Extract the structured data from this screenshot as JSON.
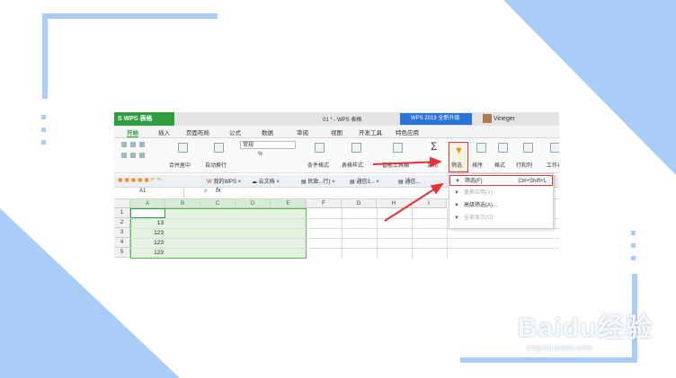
{
  "colors": {
    "frame_blue": "#a9cdf6",
    "wps_green": "#2e9e3f",
    "highlight_red": "#e33333",
    "promo_blue": "#2a73d8"
  },
  "titlebar": {
    "app_name": "S WPS 表格",
    "doc_title": "01 * - WPS 表格",
    "promo": "WPS 2019 全新升级",
    "user": "Vineger"
  },
  "ribbon_tabs": [
    "开始",
    "插入",
    "页面布局",
    "公式",
    "数据",
    "审阅",
    "视图",
    "开发工具",
    "特色应用"
  ],
  "ribbon": {
    "number_format": "常规",
    "percent": "%",
    "labels": {
      "merge": "合并居中",
      "wrap": "自动换行",
      "cond_format": "条件格式",
      "table_style": "表格样式",
      "smart_tools": "智能工具箱",
      "sum": "求和",
      "filter": "筛选",
      "sort": "排序",
      "format": "格式",
      "rowcol": "行和列",
      "worksheet": "工作表"
    }
  },
  "doc_tabs": [
    "我的WPS",
    "云文档",
    "民政...行)",
    "通信3...",
    "通信..."
  ],
  "formula_bar": {
    "cell_ref": "A1",
    "fx": "fx"
  },
  "grid": {
    "columns": [
      "A",
      "B",
      "C",
      "D",
      "E",
      "F",
      "G",
      "H",
      "I"
    ],
    "rows": [
      "1",
      "2",
      "3",
      "4",
      "5"
    ],
    "a_values": [
      "",
      "13",
      "123",
      "123",
      "123"
    ]
  },
  "filter_menu": {
    "items": [
      {
        "label": "筛选(F)",
        "shortcut": "Ctrl+Shift+L",
        "enabled": true
      },
      {
        "label": "重新应用(Y)",
        "shortcut": "",
        "enabled": false
      },
      {
        "label": "高级筛选(A)...",
        "shortcut": "",
        "enabled": true
      },
      {
        "label": "全部显示(C)",
        "shortcut": "",
        "enabled": false
      }
    ]
  },
  "watermark": {
    "brand": "Baidu经验",
    "url": "jingyan.baidu.com"
  }
}
